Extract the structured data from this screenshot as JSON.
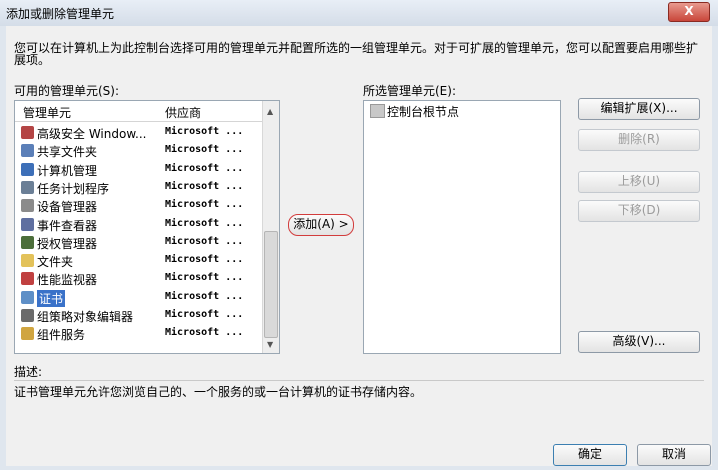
{
  "window": {
    "title": "添加或删除管理单元",
    "close_label": "X"
  },
  "intro": "您可以在计算机上为此控制台选择可用的管理单元并配置所选的一组管理单元。对于可扩展的管理单元，您可以配置要启用哪些扩展项。",
  "available": {
    "label": "可用的管理单元(S):",
    "col_snapin": "管理单元",
    "col_vendor": "供应商",
    "items": [
      {
        "name": "高级安全 Window...",
        "vendor": "Microsoft ...",
        "icon": "shield-icon",
        "color": "#b44545"
      },
      {
        "name": "共享文件夹",
        "vendor": "Microsoft ...",
        "icon": "shared-folder-icon",
        "color": "#5b7fb8"
      },
      {
        "name": "计算机管理",
        "vendor": "Microsoft ...",
        "icon": "computer-management-icon",
        "color": "#3d6fb8"
      },
      {
        "name": "任务计划程序",
        "vendor": "Microsoft ...",
        "icon": "clock-icon",
        "color": "#6b7f96"
      },
      {
        "name": "设备管理器",
        "vendor": "Microsoft ...",
        "icon": "device-manager-icon",
        "color": "#8b8b8b"
      },
      {
        "name": "事件查看器",
        "vendor": "Microsoft ...",
        "icon": "event-viewer-icon",
        "color": "#5f6fa0"
      },
      {
        "name": "授权管理器",
        "vendor": "Microsoft ...",
        "icon": "authorization-icon",
        "color": "#4c6e3a"
      },
      {
        "name": "文件夹",
        "vendor": "Microsoft ...",
        "icon": "folder-icon",
        "color": "#e3c25a"
      },
      {
        "name": "性能监视器",
        "vendor": "Microsoft ...",
        "icon": "performance-icon",
        "color": "#c04040"
      },
      {
        "name": "证书",
        "vendor": "Microsoft ...",
        "icon": "certificate-icon",
        "color": "#5e8fc7"
      },
      {
        "name": "组策略对象编辑器",
        "vendor": "Microsoft ...",
        "icon": "group-policy-icon",
        "color": "#6b6b6b"
      },
      {
        "name": "组件服务",
        "vendor": "Microsoft ...",
        "icon": "component-services-icon",
        "color": "#d0a540"
      }
    ]
  },
  "add_button": "添加(A) >",
  "selected": {
    "label": "所选管理单元(E):",
    "root_node": "控制台根节点"
  },
  "buttons": {
    "edit_ext": "编辑扩展(X)...",
    "remove": "删除(R)",
    "move_up": "上移(U)",
    "move_down": "下移(D)",
    "advanced": "高级(V)...",
    "ok": "确定",
    "cancel": "取消"
  },
  "description": {
    "label": "描述:",
    "text": "证书管理单元允许您浏览自己的、一个服务的或一台计算机的证书存储内容。"
  }
}
